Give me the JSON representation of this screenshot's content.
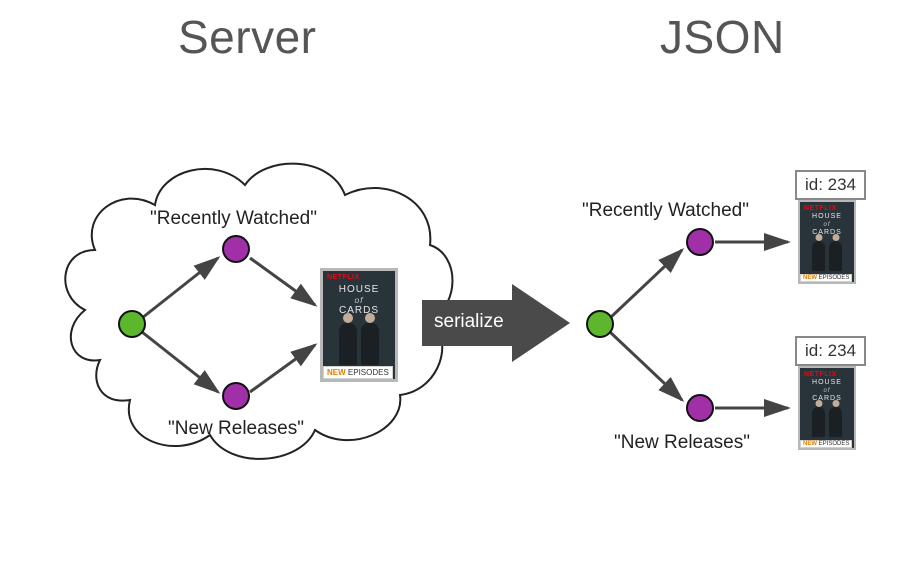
{
  "headings": {
    "left": "Server",
    "right": "JSON"
  },
  "arrow_label": "serialize",
  "server": {
    "top_label": "\"Recently Watched\"",
    "bottom_label": "\"New Releases\""
  },
  "json": {
    "top_label": "\"Recently Watched\"",
    "bottom_label": "\"New Releases\"",
    "top_id": "id: 234",
    "bottom_id": "id: 234"
  },
  "poster": {
    "brand": "NETFLIX",
    "title_line1": "HOUSE",
    "title_of": "of",
    "title_line2": "CARDS",
    "badge_new": "NEW",
    "badge_rest": " EPISODES"
  }
}
